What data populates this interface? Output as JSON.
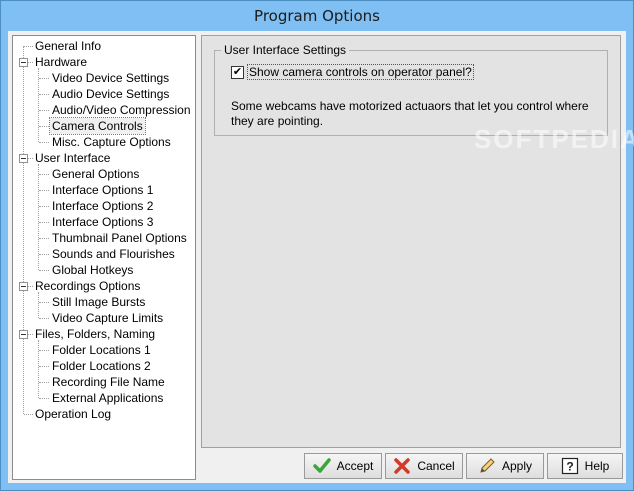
{
  "window": {
    "title": "Program Options"
  },
  "tree": {
    "items": [
      {
        "label": "General Info",
        "level": 0,
        "expandable": false,
        "selected": false
      },
      {
        "label": "Hardware",
        "level": 0,
        "expandable": true,
        "selected": false
      },
      {
        "label": "Video Device Settings",
        "level": 1,
        "expandable": false,
        "selected": false
      },
      {
        "label": "Audio Device Settings",
        "level": 1,
        "expandable": false,
        "selected": false
      },
      {
        "label": "Audio/Video Compression",
        "level": 1,
        "expandable": false,
        "selected": false
      },
      {
        "label": "Camera Controls",
        "level": 1,
        "expandable": false,
        "selected": true
      },
      {
        "label": "Misc. Capture Options",
        "level": 1,
        "expandable": false,
        "selected": false
      },
      {
        "label": "User Interface",
        "level": 0,
        "expandable": true,
        "selected": false
      },
      {
        "label": "General Options",
        "level": 1,
        "expandable": false,
        "selected": false
      },
      {
        "label": "Interface Options 1",
        "level": 1,
        "expandable": false,
        "selected": false
      },
      {
        "label": "Interface Options 2",
        "level": 1,
        "expandable": false,
        "selected": false
      },
      {
        "label": "Interface Options 3",
        "level": 1,
        "expandable": false,
        "selected": false
      },
      {
        "label": "Thumbnail Panel Options",
        "level": 1,
        "expandable": false,
        "selected": false
      },
      {
        "label": "Sounds and Flourishes",
        "level": 1,
        "expandable": false,
        "selected": false
      },
      {
        "label": "Global Hotkeys",
        "level": 1,
        "expandable": false,
        "selected": false
      },
      {
        "label": "Recordings Options",
        "level": 0,
        "expandable": true,
        "selected": false
      },
      {
        "label": "Still Image Bursts",
        "level": 1,
        "expandable": false,
        "selected": false
      },
      {
        "label": "Video Capture Limits",
        "level": 1,
        "expandable": false,
        "selected": false
      },
      {
        "label": "Files, Folders, Naming",
        "level": 0,
        "expandable": true,
        "selected": false
      },
      {
        "label": "Folder Locations 1",
        "level": 1,
        "expandable": false,
        "selected": false
      },
      {
        "label": "Folder Locations 2",
        "level": 1,
        "expandable": false,
        "selected": false
      },
      {
        "label": "Recording File Name",
        "level": 1,
        "expandable": false,
        "selected": false
      },
      {
        "label": "External Applications",
        "level": 1,
        "expandable": false,
        "selected": false
      },
      {
        "label": "Operation Log",
        "level": 0,
        "expandable": false,
        "selected": false
      }
    ]
  },
  "panel": {
    "group_title": "User Interface Settings",
    "checkbox": {
      "label": "Show camera controls on operator panel?",
      "checked": true
    },
    "description": "Some webcams have motorized actuaors that let you control where they are pointing.",
    "watermark": "SOFTPEDIA"
  },
  "buttons": {
    "accept": "Accept",
    "cancel": "Cancel",
    "apply": "Apply",
    "help": "Help"
  },
  "icons": {
    "accept": "green-checkmark-icon",
    "cancel": "red-x-icon",
    "apply": "pencil-icon",
    "help": "question-mark-icon"
  },
  "colors": {
    "titlebar": "#7fbff3",
    "accept_icon": "#3aa53a",
    "cancel_icon": "#d23a2a"
  }
}
